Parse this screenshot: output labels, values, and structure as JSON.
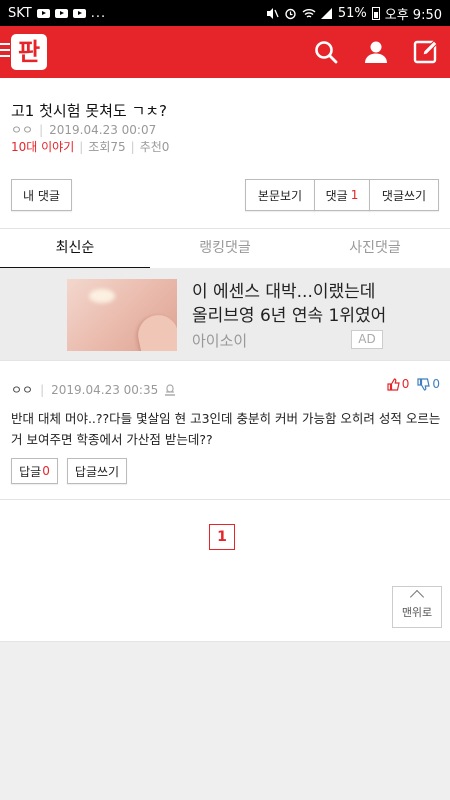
{
  "status": {
    "carrier": "SKT",
    "dots": "...",
    "battery": "51%",
    "time": "오후 9:50"
  },
  "appbar": {
    "logo": "판",
    "icons": [
      "menu-icon",
      "search-icon",
      "user-icon",
      "write-icon"
    ]
  },
  "post": {
    "title": "고1 첫시험 못쳐도 ㄱㅊ?",
    "author": "ㅇㅇ",
    "datetime": "2019.04.23 00:07",
    "category": "10대 이야기",
    "views": "조회75",
    "recommends": "추천0"
  },
  "actions": {
    "my_comments": "내 댓글",
    "view_post": "본문보기",
    "comments_label": "댓글",
    "comments_count": "1",
    "write_comment": "댓글쓰기"
  },
  "tabs": [
    "최신순",
    "랭킹댓글",
    "사진댓글"
  ],
  "ad": {
    "line1": "이 에센스 대박...이랬는데",
    "line2": "올리브영 6년 연속 1위였어",
    "brand": "아이소이",
    "badge": "AD"
  },
  "comment": {
    "author": "ㅇㅇ",
    "datetime": "2019.04.23 00:35",
    "up": "0",
    "down": "0",
    "text": "반대 대체 머야..??다들 몇살임 현 고3인데 충분히 커버 가능함 오히려 성적 오르는 거 보여주면 학종에서 가산점 받는데??",
    "reply_label": "답글",
    "reply_count": "0",
    "reply_write": "답글쓰기"
  },
  "pager": {
    "current": "1",
    "to_top": "맨위로"
  },
  "colors": {
    "brand_red": "#e5252a",
    "down_blue": "#3f7fbf"
  }
}
